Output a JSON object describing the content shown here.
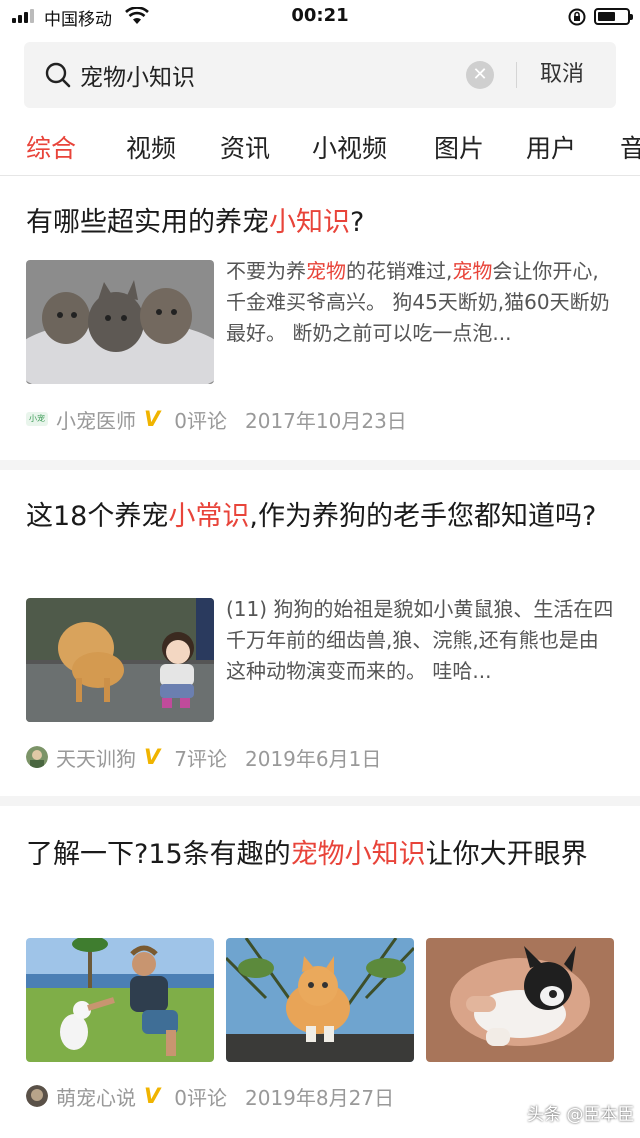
{
  "status_bar": {
    "carrier": "中国移动",
    "time": "00:21",
    "battery_level": 0.6
  },
  "search": {
    "query": "宠物小知识",
    "cancel_label": "取消"
  },
  "tabs": [
    "综合",
    "视频",
    "资讯",
    "小视频",
    "图片",
    "用户",
    "音"
  ],
  "active_tab": "综合",
  "highlight_color": "#e8443a",
  "articles": [
    {
      "title_plain": "有哪些超实用的养宠",
      "title_hl": "小知识",
      "title_tail": "?",
      "snippet_a": "不要为养",
      "snippet_hl1": "宠物",
      "snippet_b": "的花销难过,",
      "snippet_hl2": "宠物",
      "snippet_c": "会让你开心,千金难买爷高兴。 狗45天断奶,猫60天断奶最好。 断奶之前可以吃一点泡...",
      "source": "小宠医师",
      "comments": "0评论",
      "date": "2017年10月23日",
      "avatar_text": "小宠"
    },
    {
      "title_plain": "这18个养宠",
      "title_hl": "小常识",
      "title_tail": ",作为养狗的老手您都知道吗?",
      "snippet": "(11) 狗狗的始祖是貌如小黄鼠狼、生活在四千万年前的细齿兽,狼、浣熊,还有熊也是由这种动物演变而来的。 哇哈...",
      "source": "天天训狗",
      "comments": "7评论",
      "date": "2019年6月1日"
    },
    {
      "title_plain": "了解一下?15条有趣的",
      "title_hl": "宠物小知识",
      "title_tail": "让你大开眼界",
      "source": "萌宠心说",
      "comments": "0评论",
      "date": "2019年8月27日"
    }
  ],
  "watermark": "头条 @臣本臣"
}
